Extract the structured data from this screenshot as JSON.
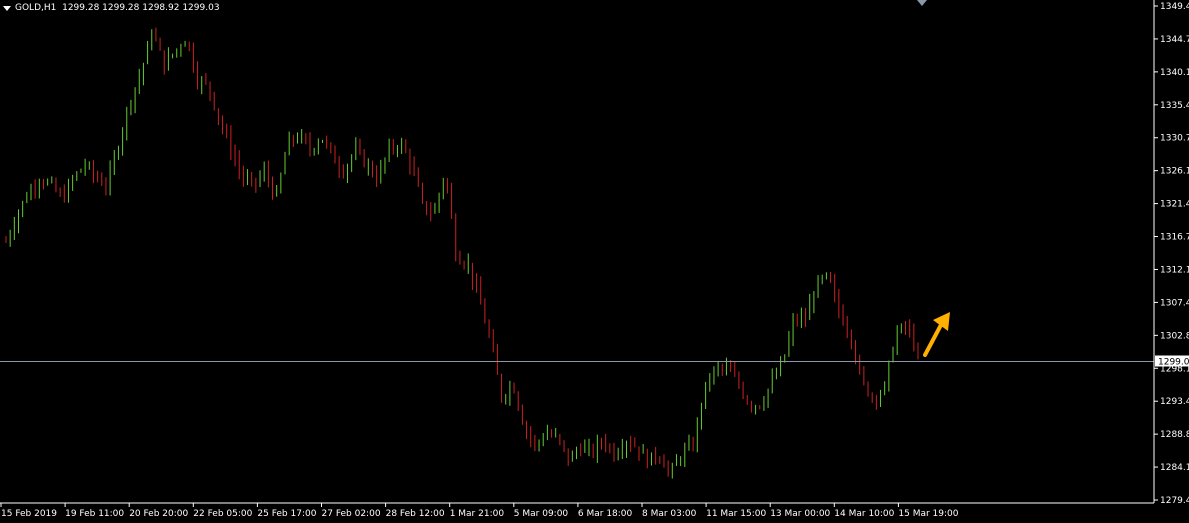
{
  "header": {
    "symbol": "GOLD,H1",
    "ohlc": "1299.28 1299.28 1298.92 1299.03"
  },
  "colors": {
    "background": "#000000",
    "bull": "#66cc33",
    "bear": "#cc2222",
    "axis": "#ffffff",
    "price_line": "#8898aa",
    "arrow": "#ffb000",
    "label_bg": "#ffffff",
    "label_text": "#000000"
  },
  "chart_data": {
    "type": "candlestick",
    "y_ticks": [
      "1349.4",
      "1344.7",
      "1340.1",
      "1335.4",
      "1330.7",
      "1326.1",
      "1321.4",
      "1316.7",
      "1312.1",
      "1307.4",
      "1302.8",
      "1298.1",
      "1293.4",
      "1288.8",
      "1284.1",
      "1279.4"
    ],
    "ylim": [
      1279.4,
      1349.4
    ],
    "x_ticks": [
      "15 Feb 2019",
      "19 Feb 11:00",
      "20 Feb 20:00",
      "22 Feb 05:00",
      "25 Feb 17:00",
      "27 Feb 02:00",
      "28 Feb 12:00",
      "1 Mar 21:00",
      "5 Mar 09:00",
      "6 Mar 18:00",
      "8 Mar 03:00",
      "11 Mar 15:00",
      "13 Mar 00:00",
      "14 Mar 10:00",
      "15 Mar 19:00"
    ],
    "current_price": "1299.03",
    "series_close": [
      1316,
      1320,
      1323,
      1325,
      1324,
      1322,
      1325,
      1327,
      1325,
      1324,
      1330,
      1336,
      1340,
      1346,
      1341,
      1343,
      1345,
      1339,
      1338,
      1333,
      1329,
      1325,
      1324,
      1326,
      1322,
      1330,
      1331,
      1329,
      1331,
      1328,
      1326,
      1329,
      1327,
      1325,
      1329,
      1330,
      1327,
      1321,
      1320,
      1326,
      1314,
      1313,
      1308,
      1302,
      1294,
      1296,
      1290,
      1287,
      1289,
      1288,
      1285,
      1287,
      1286,
      1288,
      1286,
      1288,
      1287,
      1285,
      1286,
      1283,
      1286,
      1287,
      1295,
      1298,
      1298,
      1296,
      1293,
      1293,
      1296,
      1299,
      1305,
      1305,
      1310,
      1311,
      1306,
      1303,
      1296,
      1294,
      1295,
      1303,
      1304,
      1300
    ]
  },
  "annotation": {
    "arrow": "up-arrow"
  }
}
